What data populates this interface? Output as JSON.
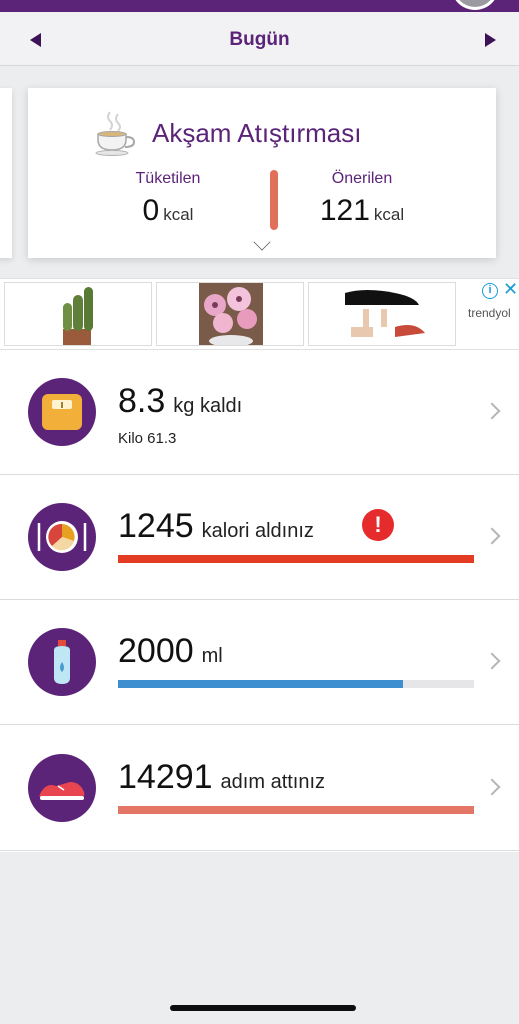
{
  "header": {
    "date_label": "Bugün",
    "prev_day_icon": "triangle-left-icon",
    "next_day_icon": "triangle-right-icon"
  },
  "meal_card": {
    "icon": "tea-cup-icon",
    "title": "Akşam Atıştırması",
    "consumed_label": "Tüketilen",
    "consumed_value": "0",
    "consumed_unit": "kcal",
    "recommended_label": "Önerilen",
    "recommended_value": "121",
    "recommended_unit": "kcal",
    "divider_color": "#e0705a"
  },
  "ad": {
    "brand": "trendyol",
    "info_glyph": "i",
    "close_glyph": "✕",
    "tiles": [
      "cactus-plant-image",
      "flower-pot-image",
      "insole-shoes-image"
    ]
  },
  "summary": {
    "weight": {
      "icon": "scale-icon",
      "value": "8.3",
      "suffix": "kg kaldı",
      "sub": "Kilo 61.3"
    },
    "calories": {
      "icon": "plate-icon",
      "value": "1245",
      "suffix": "kalori aldınız",
      "alert_glyph": "!",
      "progress": 1.0,
      "bar_color": "#e43c23"
    },
    "water": {
      "icon": "water-bottle-icon",
      "value": "2000",
      "suffix": "ml",
      "progress": 0.8,
      "bar_color": "#3d8fd0"
    },
    "steps": {
      "icon": "running-shoe-icon",
      "value": "14291",
      "suffix": "adım attınız",
      "progress": 1.0,
      "bar_color": "#e37665"
    }
  },
  "colors": {
    "brand_purple": "#5b2479",
    "page_background": "#ecedef"
  }
}
